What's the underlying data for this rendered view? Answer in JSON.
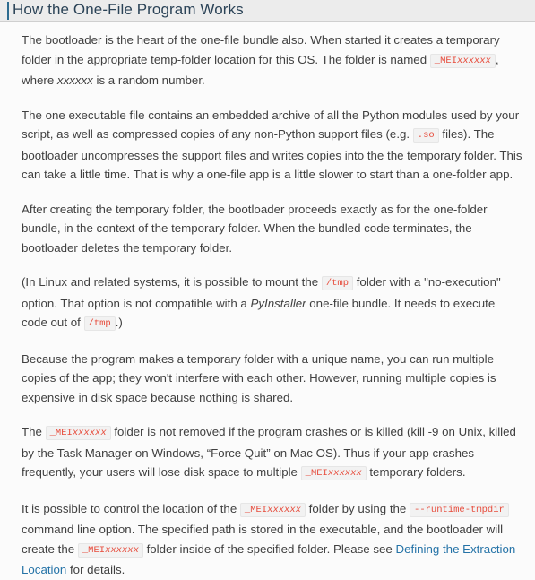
{
  "header": {
    "title": "How the One-File Program Works",
    "accent_color": "#2c6b8f",
    "background_color": "#ececec",
    "title_color": "#2b4357"
  },
  "theme": {
    "text_color": "#404040",
    "code_color": "#e74c3c",
    "code_background": "#f2f2f2",
    "link_color": "#2573a7",
    "page_background": "#fbfbfb"
  },
  "code_tokens": {
    "mei_prefix": "_MEI",
    "mei_suffix": "xxxxxx",
    "so": ".so",
    "tmp": "/tmp",
    "runtime_tmpdir": "--runtime-tmpdir"
  },
  "paragraphs": {
    "p1": {
      "t1": "The bootloader is the heart of the one-file bundle also. When started it creates a temporary folder in the appropriate temp-folder location for this OS. The folder is named ",
      "t2": ", where ",
      "em1": "xxxxxx",
      "t3": " is a random number."
    },
    "p2": {
      "t1": "The one executable file contains an embedded archive of all the Python modules used by your script, as well as compressed copies of any non-Python support files (e.g. ",
      "t2": " files). The bootloader uncompresses the support files and writes copies into the the temporary folder. This can take a little time. That is why a one-file app is a little slower to start than a one-folder app."
    },
    "p3": {
      "t1": "After creating the temporary folder, the bootloader proceeds exactly as for the one-folder bundle, in the context of the temporary folder. When the bundled code terminates, the bootloader deletes the temporary folder."
    },
    "p4": {
      "t1": "(In Linux and related systems, it is possible to mount the ",
      "t2": " folder with a \"no-execution\" option. That option is not compatible with a ",
      "em1": "PyInstaller",
      "t3": " one-file bundle. It needs to execute code out of ",
      "t4": ".)"
    },
    "p5": {
      "t1": "Because the program makes a temporary folder with a unique name, you can run multiple copies of the app; they won't interfere with each other. However, running multiple copies is expensive in disk space because nothing is shared."
    },
    "p6": {
      "t1": "The ",
      "t2": " folder is not removed if the program crashes or is killed (kill -9 on Unix, killed by the Task Manager on Windows, “Force Quit” on Mac OS). Thus if your app crashes frequently, your users will lose disk space to multiple ",
      "t3": " temporary folders."
    },
    "p7": {
      "t1": "It is possible to control the location of the ",
      "t2": " folder by using the ",
      "t3": " command line option. The specified path is stored in the executable, and the bootloader will create the ",
      "t4": " folder inside of the specified folder. Please see ",
      "link": "Defining the Extraction Location",
      "t5": " for details."
    }
  }
}
